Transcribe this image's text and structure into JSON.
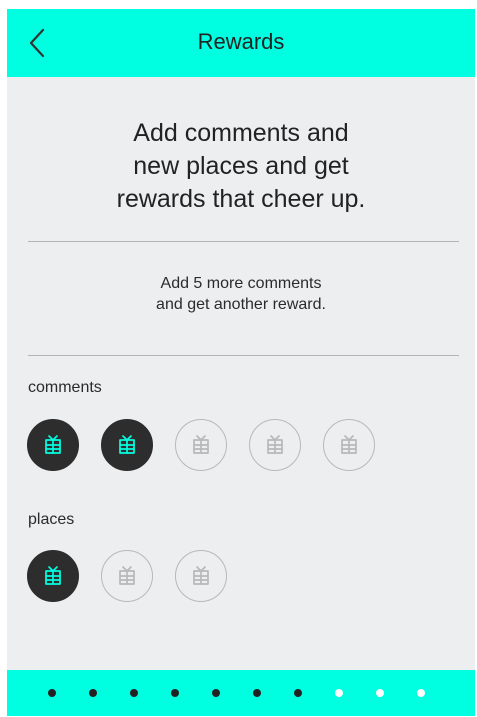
{
  "header": {
    "title": "Rewards",
    "back_icon": "chevron-left-icon"
  },
  "main": {
    "intro_line_1": "Add comments and",
    "intro_line_2": "new places and get",
    "intro_line_3": "rewards that cheer up.",
    "progress_line_1": "Add 5 more comments",
    "progress_line_2": "and get another reward."
  },
  "sections": {
    "comments": {
      "label": "comments",
      "earned": 2,
      "total": 5
    },
    "places": {
      "label": "places",
      "earned": 1,
      "total": 3
    }
  },
  "icons": {
    "reward_icon": "gift-icon"
  },
  "pagination": {
    "dots": [
      {
        "filled": true
      },
      {
        "filled": true
      },
      {
        "filled": true
      },
      {
        "filled": true
      },
      {
        "filled": true
      },
      {
        "filled": true
      },
      {
        "filled": true
      },
      {
        "filled": false
      },
      {
        "filled": false
      },
      {
        "filled": false
      }
    ]
  },
  "colors": {
    "accent": "#00ffe1",
    "background": "#eceef0",
    "earned_badge": "#2d2d2d",
    "earned_icon": "#00ffe1",
    "locked_border": "#b8b8b8",
    "locked_icon": "#b8b8b8",
    "dot_filled": "#222222",
    "dot_empty": "#ffffff"
  }
}
